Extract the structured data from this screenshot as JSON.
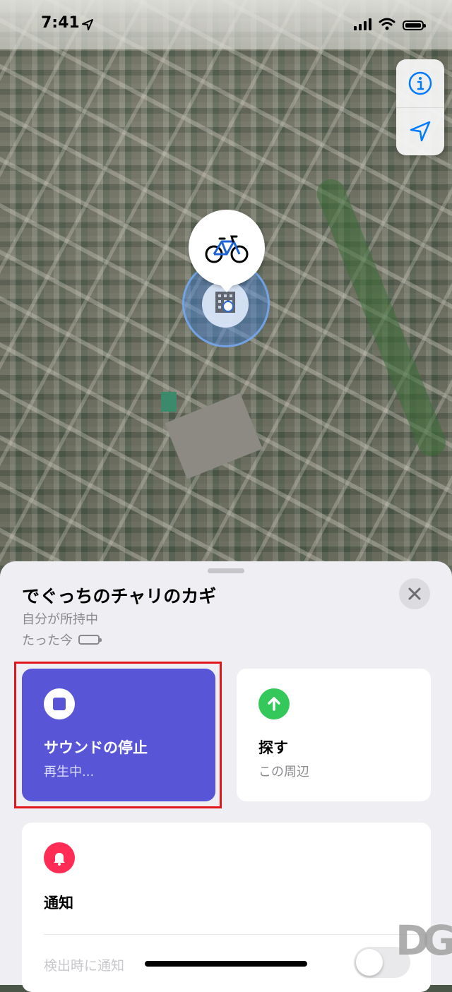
{
  "status_bar": {
    "time": "7:41",
    "location_icon": "location-arrow-icon",
    "signal_icon": "cellular-signal-icon",
    "wifi_icon": "wifi-icon",
    "battery_icon": "battery-icon"
  },
  "map": {
    "controls": [
      {
        "icon": "info-icon"
      },
      {
        "icon": "location-arrow-icon"
      }
    ],
    "item_pin_icon": "bicycle-icon",
    "location_marker_icon": "building-icon"
  },
  "sheet": {
    "title": "でぐっちのチャリのカギ",
    "owner": "自分が所持中",
    "last_seen": "たった今",
    "close_icon": "close-icon",
    "actions": {
      "sound": {
        "label": "サウンドの停止",
        "sub": "再生中...",
        "icon": "stop-icon"
      },
      "find": {
        "label": "探す",
        "sub": "この周辺",
        "icon": "arrow-up-icon"
      }
    },
    "notifications": {
      "label": "通知",
      "icon": "bell-icon",
      "detect_label": "検出時に通知",
      "detect_enabled": false
    }
  },
  "colors": {
    "accent_sound": "#5856d6",
    "find_green": "#34c759",
    "notify_red": "#ff2d55",
    "ios_blue": "#007aff",
    "highlight_red": "#e0181b"
  },
  "watermark": "DG"
}
